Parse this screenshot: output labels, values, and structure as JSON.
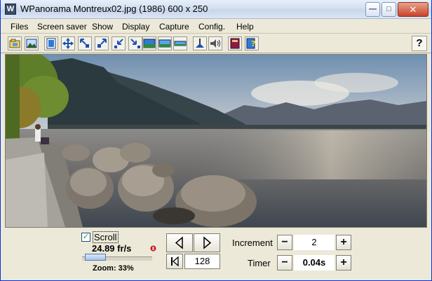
{
  "window": {
    "app_name": "WPanorama",
    "title": "WPanorama  Montreux02.jpg   (1986) 600 x 250",
    "min_glyph": "—",
    "max_glyph": "□",
    "close_glyph": "✕"
  },
  "menu": [
    {
      "label": "Files"
    },
    {
      "label": "Screen saver"
    },
    {
      "label": "Show"
    },
    {
      "label": "Display"
    },
    {
      "label": "Capture"
    },
    {
      "label": "Config."
    },
    {
      "label": "Help"
    }
  ],
  "toolbar": {
    "help_label": "?",
    "icons": [
      "open-icon",
      "picture-icon",
      "frame-icon",
      "move-icon",
      "shrink-left-icon",
      "expand-up-icon",
      "shrink-down-icon",
      "expand-right-icon",
      "display-full-icon",
      "display-wide-icon",
      "display-strip-icon",
      "sound-level-icon",
      "speaker-icon",
      "book-icon",
      "help-book-icon"
    ]
  },
  "controls": {
    "scroll_label": "Scroll",
    "scroll_checked": true,
    "fps": "24.89 fr/s",
    "zoom": "Zoom: 33%",
    "zoom_fraction": 0.33,
    "frame_number": "128",
    "increment_label": "Increment",
    "increment_value": "2",
    "timer_label": "Timer",
    "timer_value": "0.04s",
    "minus": "−",
    "plus": "+"
  },
  "colors": {
    "accent": "#0831D9",
    "close_red": "#C8432A"
  }
}
